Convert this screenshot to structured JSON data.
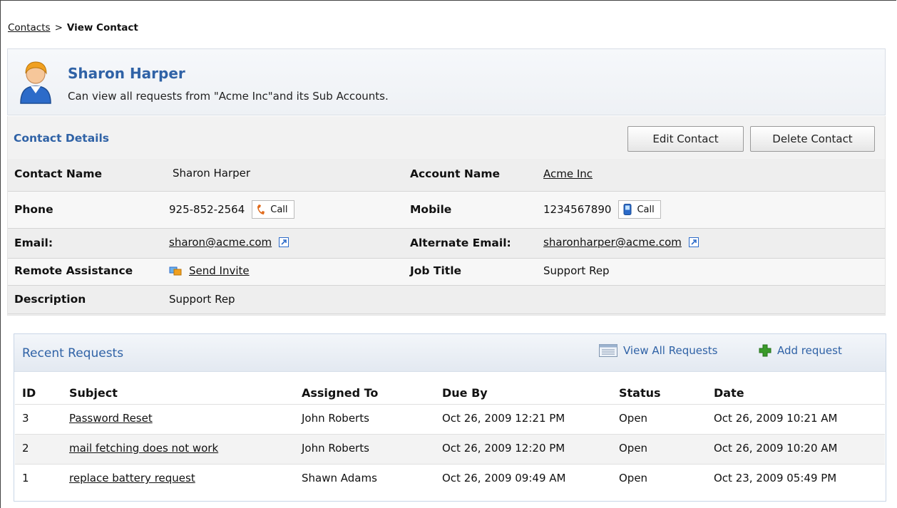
{
  "breadcrumb": {
    "parent": "Contacts",
    "separator": ">",
    "current": "View Contact"
  },
  "header": {
    "name": "Sharon Harper",
    "description": "Can view all requests from \"Acme Inc\"and its Sub Accounts.",
    "avatar_icon": "user-avatar-icon"
  },
  "details": {
    "section_title": "Contact Details",
    "edit_label": "Edit Contact",
    "delete_label": "Delete Contact",
    "contact_name_label": "Contact Name",
    "contact_name": "Sharon Harper",
    "account_name_label": "Account Name",
    "account_name": "Acme Inc",
    "phone_label": "Phone",
    "phone": "925-852-2564",
    "mobile_label": "Mobile",
    "mobile": "1234567890",
    "call_label": "Call",
    "email_label": "Email:",
    "email": "sharon@acme.com",
    "alt_email_label": "Alternate Email:",
    "alt_email": "sharonharper@acme.com",
    "remote_label": "Remote Assistance",
    "remote_link": "Send Invite",
    "job_title_label": "Job Title",
    "job_title": "Support Rep",
    "description_label": "Description",
    "description": "Support Rep"
  },
  "requests": {
    "title": "Recent Requests",
    "view_all_label": "View All Requests",
    "add_label": "Add request",
    "columns": [
      "ID",
      "Subject",
      "Assigned To",
      "Due By",
      "Status",
      "Date"
    ],
    "rows": [
      {
        "id": "3",
        "subject": "Password Reset",
        "assigned": "John Roberts",
        "due": "Oct 26, 2009 12:21 PM",
        "status": "Open",
        "date": "Oct 26, 2009 10:21 AM"
      },
      {
        "id": "2",
        "subject": "mail fetching does not work",
        "assigned": "John Roberts",
        "due": "Oct 26, 2009 12:20 PM",
        "status": "Open",
        "date": "Oct 26, 2009 10:20 AM"
      },
      {
        "id": "1",
        "subject": "replace battery request",
        "assigned": "Shawn Adams",
        "due": "Oct 26, 2009 09:49 AM",
        "status": "Open",
        "date": "Oct 23, 2009 05:49 PM"
      }
    ]
  },
  "colors": {
    "accent": "#2f62a6",
    "add_green": "#3a9a2a",
    "phone_orange": "#e06a1b"
  }
}
